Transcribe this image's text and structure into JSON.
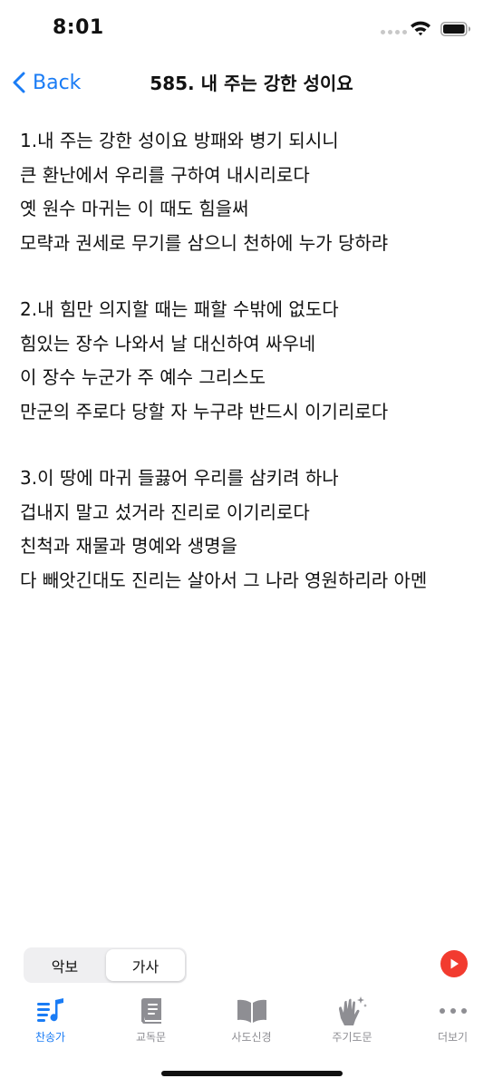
{
  "status_bar": {
    "time": "8:01"
  },
  "nav": {
    "back_label": "Back",
    "title": "585. 내 주는 강한 성이요"
  },
  "lyrics": {
    "verses": [
      [
        "1.내 주는 강한 성이요 방패와 병기 되시니",
        "큰 환난에서 우리를 구하여 내시리로다",
        "옛 원수 마귀는 이 때도 힘을써",
        "모략과 권세로 무기를 삼으니 천하에 누가 당하랴"
      ],
      [
        "2.내 힘만 의지할 때는 패할 수밖에 없도다",
        "힘있는 장수 나와서 날 대신하여 싸우네",
        "이 장수 누군가 주 예수 그리스도",
        "만군의 주로다 당할 자 누구랴 반드시 이기리로다"
      ],
      [
        "3.이 땅에 마귀 들끓어 우리를 삼키려 하나",
        "겁내지 말고 섰거라 진리로 이기리로다",
        "친척과 재물과 명예와 생명을",
        "다 빼앗긴대도 진리는 살아서 그 나라 영원하리라 아멘"
      ]
    ]
  },
  "segmented": {
    "score_label": "악보",
    "lyrics_label": "가사",
    "selected": "가사"
  },
  "tabs": [
    {
      "label": "찬송가",
      "icon": "music-list-icon",
      "active": true
    },
    {
      "label": "교독문",
      "icon": "book-icon",
      "active": false
    },
    {
      "label": "사도신경",
      "icon": "open-book-icon",
      "active": false
    },
    {
      "label": "주기도문",
      "icon": "praying-hands-icon",
      "active": false
    },
    {
      "label": "더보기",
      "icon": "more-icon",
      "active": false
    }
  ],
  "colors": {
    "accent": "#1a7cf5",
    "play": "#f23b2f",
    "inactive": "#8e8e93"
  }
}
